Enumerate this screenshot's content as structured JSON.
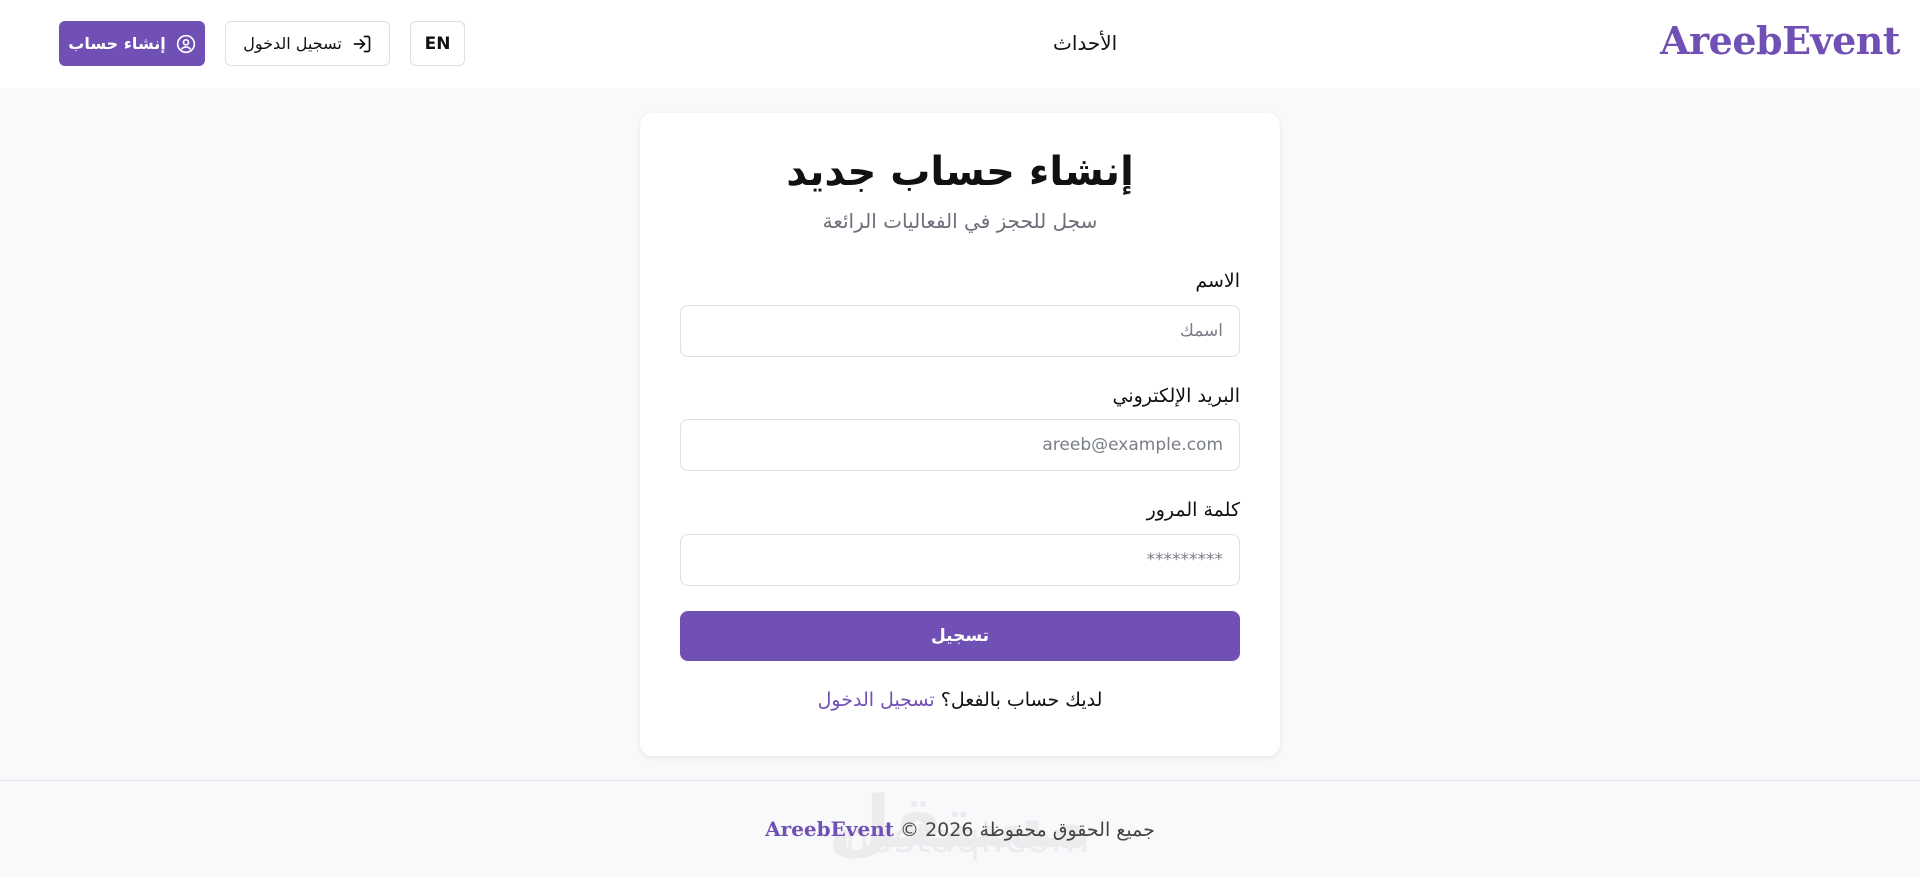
{
  "header": {
    "brand": "AreebEvent",
    "nav_events": "الأحداث",
    "signup_label": "إنشاء حساب",
    "login_label": "تسجيل الدخول",
    "lang_label": "EN"
  },
  "form": {
    "title": "إنشاء حساب جديد",
    "subtitle": "سجل للحجز في الفعاليات الرائعة",
    "name_label": "الاسم",
    "name_placeholder": "اسمك",
    "email_label": "البريد الإلكتروني",
    "email_placeholder": "areeb@example.com",
    "password_label": "كلمة المرور",
    "password_placeholder": "*********",
    "submit_label": "تسجيل",
    "have_account_text": "لديك حساب بالفعل؟",
    "login_link": "تسجيل الدخول"
  },
  "footer": {
    "rights_text": "جميع الحقوق محفوظة",
    "brand": "AreebEvent",
    "copyright": "© 2026"
  },
  "watermark": {
    "arabic": "مستقل",
    "latin": "mostaql.com"
  },
  "colors": {
    "accent": "#7050b4",
    "page_bg": "#f8f9fb",
    "card_bg": "#ffffff"
  }
}
